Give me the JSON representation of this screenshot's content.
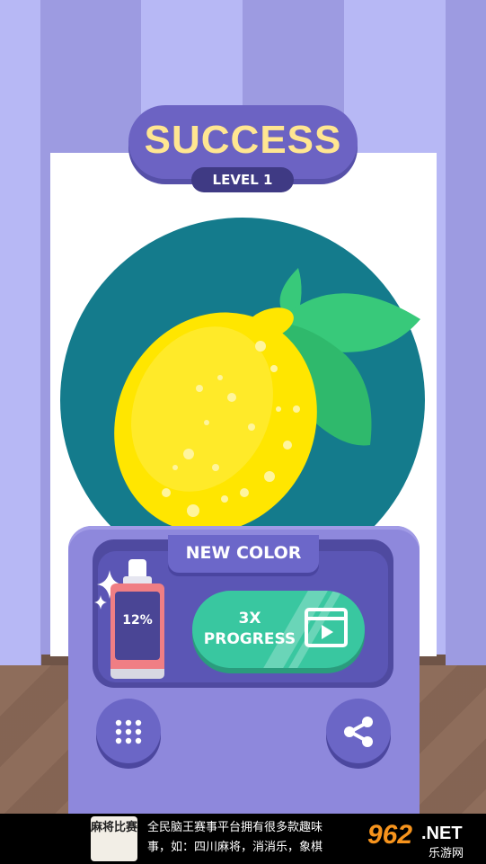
{
  "header": {
    "title": "SUCCESS",
    "level": "LEVEL 1"
  },
  "panel": {
    "tab_label": "NEW COLOR",
    "spray_percent": "12%",
    "progress_button": {
      "line1": "3X",
      "line2": "PROGRESS"
    }
  },
  "buttons": {
    "menu_icon": "grid-icon",
    "share_icon": "share-icon"
  },
  "ad": {
    "line1": "全民脑王赛事平台拥有很多款趣味",
    "line2": "事，如：四川麻将，消消乐，象棋",
    "thumb_text": "麻将比赛",
    "logo_main": "962",
    "logo_net": ".NET",
    "logo_sub": "乐游网"
  },
  "colors": {
    "wall_light": "#b6b9f7",
    "wall_dark": "#9c9be0",
    "circle": "#147b8c",
    "lemon": "#ffe600",
    "leaf": "#38c97a",
    "panel": "#8e88dc",
    "accent_green": "#39c7a0",
    "title_yellow": "#ffe691"
  }
}
